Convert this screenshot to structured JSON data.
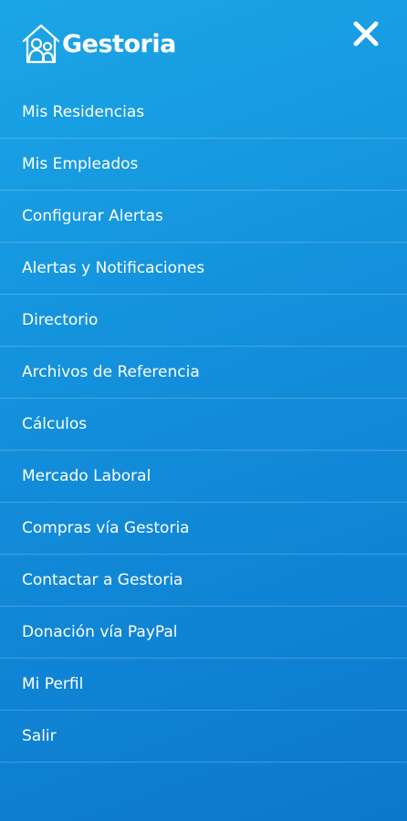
{
  "app": {
    "logo_text": "Gestoria",
    "logo_icon": "house-people-icon",
    "close_icon": "close-icon"
  },
  "colors": {
    "background_top": "#1ba6e6",
    "background_bottom": "#0c78cc",
    "text": "#ffffff"
  },
  "menu": {
    "items": [
      {
        "label": "Mis Residencias"
      },
      {
        "label": "Mis Empleados"
      },
      {
        "label": "Configurar Alertas"
      },
      {
        "label": "Alertas y Notificaciones"
      },
      {
        "label": "Directorio"
      },
      {
        "label": "Archivos de Referencia"
      },
      {
        "label": "Cálculos"
      },
      {
        "label": "Mercado Laboral"
      },
      {
        "label": "Compras vía Gestoria"
      },
      {
        "label": "Contactar a Gestoria"
      },
      {
        "label": "Donación vía PayPal"
      },
      {
        "label": "Mi Perfil"
      },
      {
        "label": "Salir"
      }
    ]
  }
}
